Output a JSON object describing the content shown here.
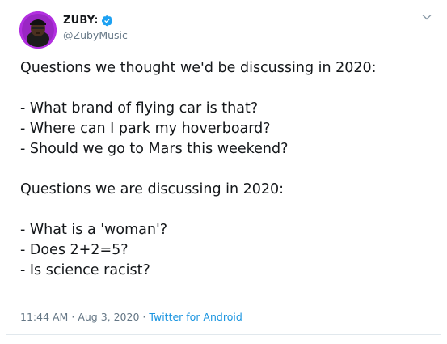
{
  "author": {
    "display_name": "ZUBY:",
    "handle": "@ZubyMusic",
    "verified": true,
    "avatar_icon": "profile-avatar",
    "avatar_bg": "#b22fe0"
  },
  "menu_icon": "chevron-down-icon",
  "tweet": {
    "paragraph1": "Questions we thought we'd be discussing in 2020:",
    "list1": [
      "- What brand of flying car is that?",
      "- Where can I park my hoverboard?",
      "- Should we go to Mars this weekend?"
    ],
    "paragraph2": "Questions we are discussing in 2020:",
    "list2": [
      "- What is a 'woman'?",
      "- Does 2+2=5?",
      "- Is science racist?"
    ]
  },
  "meta": {
    "time": "11:44 AM",
    "separator": "·",
    "date": "Aug 3, 2020",
    "source": "Twitter for Android"
  },
  "colors": {
    "text": "#14171a",
    "secondary": "#657786",
    "link": "#1b95e0",
    "verified": "#1da1f2"
  }
}
